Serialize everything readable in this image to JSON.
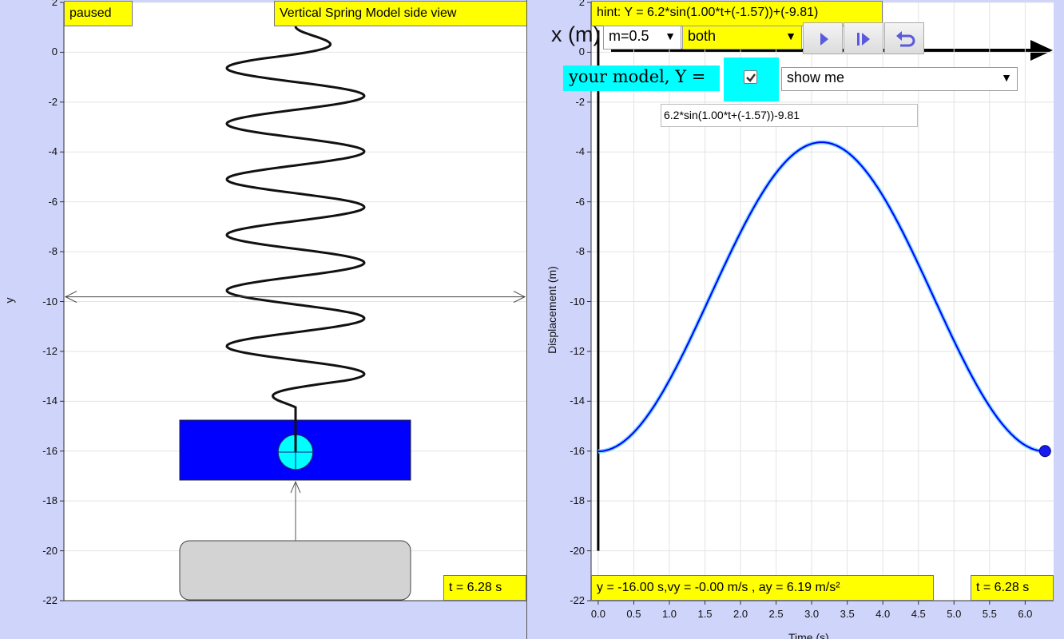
{
  "left": {
    "status": "paused",
    "title": "Vertical Spring Model side view",
    "y_axis_label": "y",
    "y_ticks": [
      "2",
      "0",
      "-2",
      "-4",
      "-6",
      "-8",
      "-10",
      "-12",
      "-14",
      "-16",
      "-18",
      "-20",
      "-22"
    ],
    "time_readout": "t = 6.28 s"
  },
  "right": {
    "hint": "hint: Y = 6.2*sin(1.00*t+(-1.57))+(-9.81)",
    "mass_select": "m=0.5",
    "view_select": "both",
    "model_label": "your model, Y =",
    "model_checkbox_checked": true,
    "show_select": "show me",
    "model_formula": "6.2*sin(1.00*t+(-1.57))-9.81",
    "background_axis_label": "x (m)",
    "y_axis_label": "Displacement (m)",
    "x_axis_label": "Time (s)",
    "y_ticks": [
      "2",
      "0",
      "-2",
      "-4",
      "-6",
      "-8",
      "-10",
      "-12",
      "-14",
      "-16",
      "-18",
      "-20",
      "-22"
    ],
    "x_ticks": [
      "0.0",
      "0.5",
      "1.0",
      "1.5",
      "2.0",
      "2.5",
      "3.0",
      "3.5",
      "4.0",
      "4.5",
      "5.0",
      "5.5",
      "6.0"
    ],
    "readout": "y = -16.00 s,vy = -0.00 m/s , ay = 6.19 m/s²",
    "time_readout": "t = 6.28 s"
  },
  "chart_data": {
    "type": "line",
    "xlabel": "Time (s)",
    "ylabel": "Displacement (m)",
    "xlim": [
      -0.1,
      6.4
    ],
    "ylim": [
      -22,
      2
    ],
    "series": [
      {
        "function": "6.2*sin(1.00*t+(-1.57))-9.81",
        "t_range": [
          0,
          6.28
        ],
        "color": "#0000ff"
      }
    ],
    "current_point": {
      "x": 6.28,
      "y": -16.0
    },
    "grid": true
  },
  "colors": {
    "panel_bg": "#cfd4fa",
    "label_bg": "#ffff00",
    "mass": "#0000ff",
    "mass_center": "#00ffff",
    "curve": "#0000ff",
    "model_bg": "#00ffff",
    "platform": "#d3d3d3"
  },
  "icons": [
    "play-icon",
    "step-icon",
    "reset-icon",
    "checkbox-check-icon"
  ]
}
